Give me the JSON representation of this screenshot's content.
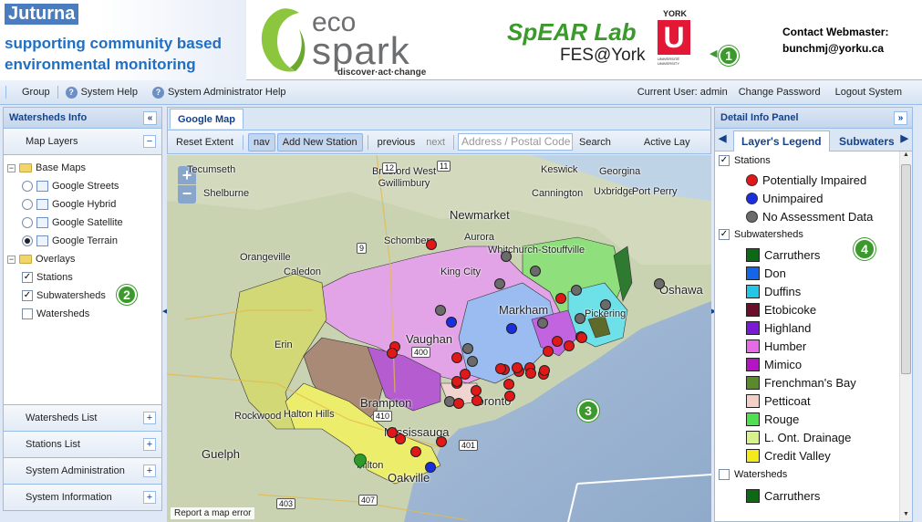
{
  "banner": {
    "brand_title": "Juturna",
    "brand_line1": "supporting community based",
    "brand_line2": "environmental monitoring",
    "eco_word1": "eco",
    "eco_word2": "spark",
    "eco_tagline": "discover·act·change",
    "spear_title": "SpEAR Lab",
    "spear_sub": "FES@York",
    "york_top": "YORK",
    "york_u": "U",
    "york_bottom": "UNIVERSITÉ UNIVERSITY",
    "badge1": "1",
    "contact_label": "Contact Webmaster:",
    "contact_email": "bunchmj@yorku.ca"
  },
  "toolbar": {
    "group": "Group",
    "system_help": "System Help",
    "admin_help": "System Administrator Help",
    "current_user": "Current User: admin",
    "change_password": "Change Password",
    "logout": "Logout System"
  },
  "left": {
    "title": "Watersheds Info",
    "collapse": "«",
    "map_layers": "Map Layers",
    "tree": {
      "base_maps": "Base Maps",
      "streets": "Google Streets",
      "hybrid": "Google Hybrid",
      "satellite": "Google Satellite",
      "terrain": "Google Terrain",
      "overlays": "Overlays",
      "stations": "Stations",
      "subwatersheds": "Subwatersheds",
      "watersheds": "Watersheds"
    },
    "badge2": "2",
    "sections": [
      "Watersheds List",
      "Stations List",
      "System Administration",
      "System Information"
    ]
  },
  "center": {
    "tab": "Google Map",
    "reset": "Reset Extent",
    "nav": "nav",
    "add_station": "Add New Station",
    "previous": "previous",
    "next": "next",
    "address_placeholder": "Address / Postal Code",
    "search": "Search",
    "active_layer": "Active Lay",
    "badge3": "3",
    "report": "Report a map error",
    "places": [
      "Tecumseth",
      "New Tecumseth",
      "Bradford West Gwillimbury",
      "Keswick",
      "Georgina",
      "Cannington",
      "Uxbridge",
      "Port Perry",
      "Shelburne",
      "Newmarket",
      "Aurora",
      "Schomberg",
      "Whitchurch-Stouffville",
      "King City",
      "Orangeville",
      "Caledon",
      "Markham",
      "Pickering",
      "Oshawa",
      "Erin",
      "Vaughan",
      "Brampton",
      "Toronto",
      "Rockwood",
      "Halton Hills",
      "Mississauga",
      "Guelph",
      "Milton",
      "Oakville"
    ],
    "road_labels": [
      "9",
      "11",
      "12",
      "410",
      "407",
      "403",
      "401",
      "400"
    ]
  },
  "right": {
    "title": "Detail Info Panel",
    "collapse": "»",
    "tab_legend": "Layer's Legend",
    "tab_subwatersheds": "Subwaters",
    "stations": "Stations",
    "potentially_impaired": "Potentially Impaired",
    "unimpaired": "Unimpaired",
    "no_data": "No Assessment Data",
    "subwatersheds": "Subwatersheds",
    "subwatershed_items": [
      {
        "name": "Carruthers",
        "color": "#0d6a14"
      },
      {
        "name": "Don",
        "color": "#1565e8"
      },
      {
        "name": "Duffins",
        "color": "#24c6e6"
      },
      {
        "name": "Etobicoke",
        "color": "#6c0f2c"
      },
      {
        "name": "Highland",
        "color": "#7a1ad6"
      },
      {
        "name": "Humber",
        "color": "#e66be6"
      },
      {
        "name": "Mimico",
        "color": "#b514c6"
      },
      {
        "name": "Frenchman's Bay",
        "color": "#5a8a2a"
      },
      {
        "name": "Petticoat",
        "color": "#f2d0c8"
      },
      {
        "name": "Rouge",
        "color": "#4fe04f"
      },
      {
        "name": "L. Ont. Drainage",
        "color": "#d7f28b"
      },
      {
        "name": "Credit Valley",
        "color": "#f2ea1a"
      }
    ],
    "watersheds": "Watersheds",
    "watershed_first": "Carruthers",
    "badge4": "4"
  },
  "colors": {
    "impaired": "#e01818",
    "unimpaired": "#1a2ee0",
    "no_data": "#6b6b6b",
    "header_text": "#15428b",
    "badge": "#3c9a2d"
  }
}
